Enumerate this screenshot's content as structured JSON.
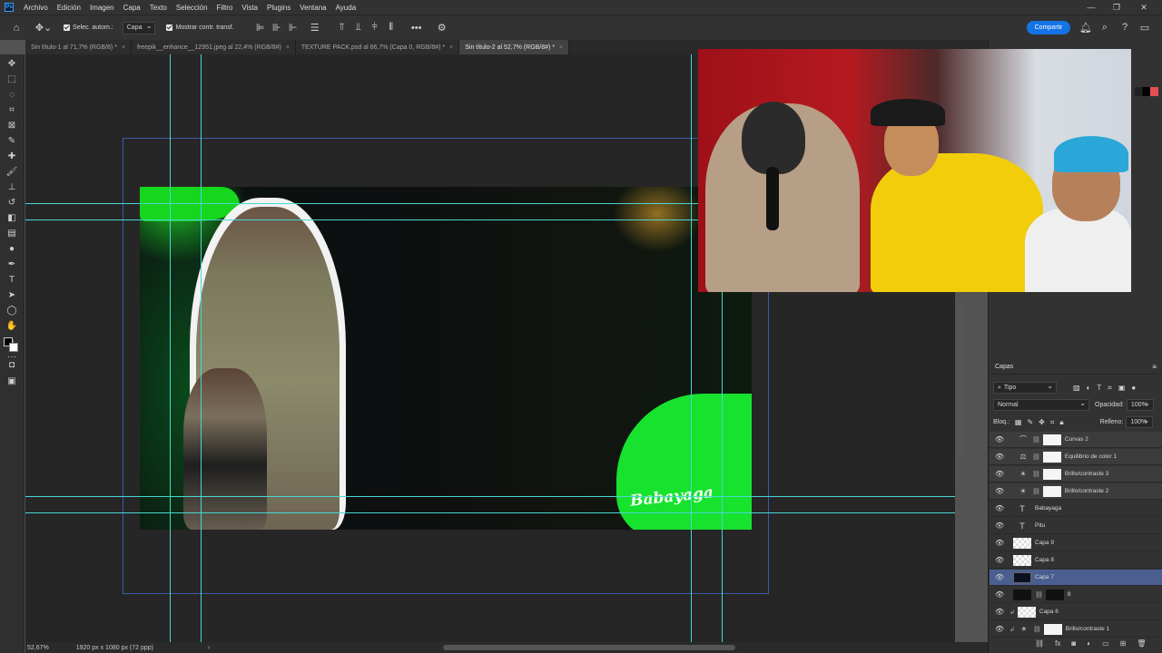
{
  "menubar": {
    "app_logo": "Ps",
    "items": [
      "Archivo",
      "Edición",
      "Imagen",
      "Capa",
      "Texto",
      "Selección",
      "Filtro",
      "Vista",
      "Plugins",
      "Ventana",
      "Ayuda"
    ]
  },
  "options": {
    "auto_select_label": "Selec. autom.:",
    "auto_select_value": "Capa",
    "show_transform_label": "Mostrar contr. transf.",
    "share_label": "Compartir",
    "more": "•••"
  },
  "tabs": [
    {
      "label": "Sin título-1 al 71,7% (RGB/8) *",
      "active": false
    },
    {
      "label": "freepik__enhance__12951.jpeg al 22,4% (RGB/8#)",
      "active": false
    },
    {
      "label": "TEXTURE PACK.psd al 66,7% (Capa 0, RGB/8#) *",
      "active": false
    },
    {
      "label": "Sin título-2 al 52,7% (RGB/8#) *",
      "active": true
    }
  ],
  "tab_close": "×",
  "canvas": {
    "watermark": "Babayaga"
  },
  "layers_panel": {
    "title": "Capas",
    "filter_kind": "Tipo",
    "blend_mode": "Normal",
    "opacity_label": "Opacidad:",
    "opacity_value": "100%",
    "lock_label": "Bloq.:",
    "fill_label": "Relleno:",
    "fill_value": "100%",
    "layers": [
      {
        "name": "Curvas 2",
        "kind": "adjustment",
        "icon": "curves-icon"
      },
      {
        "name": "Equilibrio de color 1",
        "kind": "adjustment",
        "icon": "color-balance-icon"
      },
      {
        "name": "Brillo/contraste 3",
        "kind": "adjustment",
        "icon": "brightness-icon"
      },
      {
        "name": "Brillo/contraste 2",
        "kind": "adjustment",
        "icon": "brightness-icon"
      },
      {
        "name": "Babayaga",
        "kind": "text"
      },
      {
        "name": "Pitu",
        "kind": "text"
      },
      {
        "name": "Capa 9",
        "kind": "pixel"
      },
      {
        "name": "Capa 8",
        "kind": "pixel"
      },
      {
        "name": "Capa 7",
        "kind": "pixel",
        "selected": true
      },
      {
        "name": "8",
        "kind": "masked"
      },
      {
        "name": "Capa 6",
        "kind": "pixel"
      },
      {
        "name": "Brillo/contraste 1",
        "kind": "adjustment",
        "icon": "brightness-icon"
      }
    ]
  },
  "status": {
    "zoom": "52,67%",
    "doc_size": "1920 px x 1080 px (72 ppp)",
    "arrow": "›"
  },
  "colors": {
    "accent": "#1473e6",
    "guide": "#49d6d2",
    "selected_layer": "#4a5e90",
    "splash_green": "#17e22e"
  }
}
